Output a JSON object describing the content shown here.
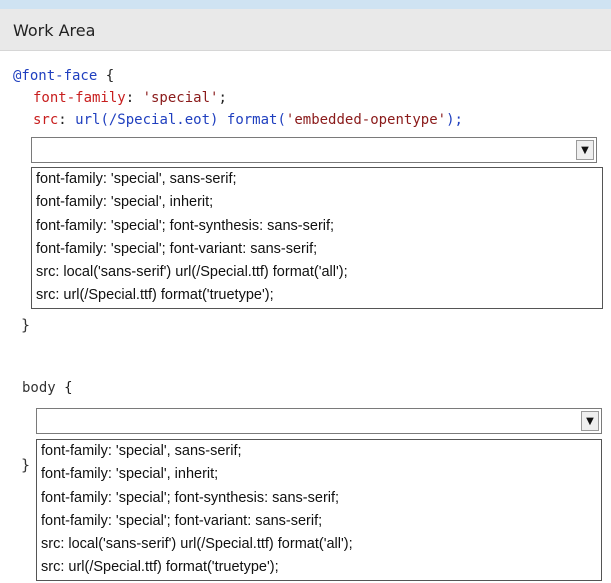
{
  "header": {
    "title": "Work Area"
  },
  "fontface": {
    "selector": "@font-face",
    "open": "{",
    "prop1": "font-family",
    "val1": "'special'",
    "prop2": "src",
    "val2a": "url(/Special.eot)",
    "val2b": "format(",
    "val2c": "'embedded-opentype'",
    "val2d": ");",
    "close": "}",
    "select_value": "",
    "options": [
      "font-family: 'special', sans-serif;",
      "font-family: 'special', inherit;",
      "font-family: 'special'; font-synthesis: sans-serif;",
      "font-family: 'special'; font-variant: sans-serif;",
      "src: local('sans-serif') url(/Special.ttf) format('all');",
      "src: url(/Special.ttf) format('truetype');"
    ]
  },
  "body_rule": {
    "selector": "body",
    "open": "{",
    "close": "}",
    "select_value": "",
    "options": [
      "font-family: 'special', sans-serif;",
      "font-family: 'special', inherit;",
      "font-family: 'special'; font-synthesis: sans-serif;",
      "font-family: 'special'; font-variant: sans-serif;",
      "src: local('sans-serif') url(/Special.ttf) format('all');",
      "src: url(/Special.ttf) format('truetype');"
    ]
  },
  "icons": {
    "dropdown": "chevron-down-icon"
  },
  "colors": {
    "selector": "#1f3fbf",
    "property": "#c81e1e",
    "header_bg": "#e9e9e9"
  }
}
